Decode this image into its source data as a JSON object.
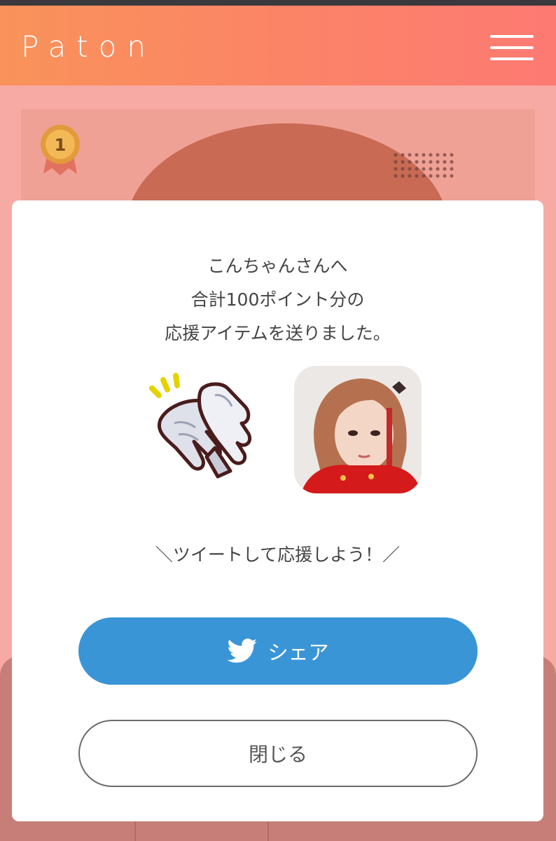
{
  "header": {
    "logo": "Paton"
  },
  "ranking": {
    "medal_number": "1"
  },
  "modal": {
    "message_lines": [
      "こんちゃんさんへ",
      "合計100ポイント分の",
      "応援アイテムを送りました。"
    ],
    "call_to_action": "＼ツイートして応援しよう！／",
    "share_label": "シェア",
    "close_label": "閉じる"
  },
  "colors": {
    "header_start": "#f9935a",
    "header_end": "#fd7a73",
    "share_button": "#3a95d7"
  }
}
